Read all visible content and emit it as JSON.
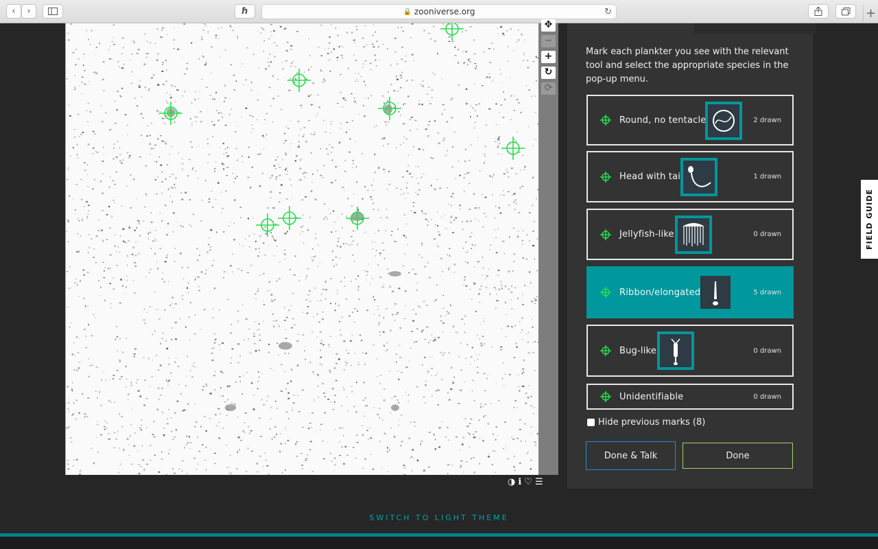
{
  "browser": {
    "url": "zooniverse.org"
  },
  "task": {
    "instructions": "Mark each plankter you see with the relevant tool and select the appropriate species in the pop-up menu.",
    "tools": [
      {
        "label": "Round, no tentacles",
        "count": "2 drawn",
        "active": false
      },
      {
        "label": "Head with tail",
        "count": "1 drawn",
        "active": false
      },
      {
        "label": "Jellyfish-like",
        "count": "0 drawn",
        "active": false
      },
      {
        "label": "Ribbon/elongated",
        "count": "5 drawn",
        "active": true
      },
      {
        "label": "Bug-like",
        "count": "0 drawn",
        "active": false
      },
      {
        "label": "Unidentifiable",
        "count": "0 drawn",
        "active": false
      }
    ],
    "hide_previous": "Hide previous marks (8)",
    "done_talk": "Done & Talk",
    "done": "Done"
  },
  "field_guide": "FIELD GUIDE",
  "theme_link": "SWITCH TO LIGHT THEME",
  "colors": {
    "accent": "#00979d",
    "mark": "#22e04a",
    "panel": "#333333",
    "background": "#262626"
  }
}
